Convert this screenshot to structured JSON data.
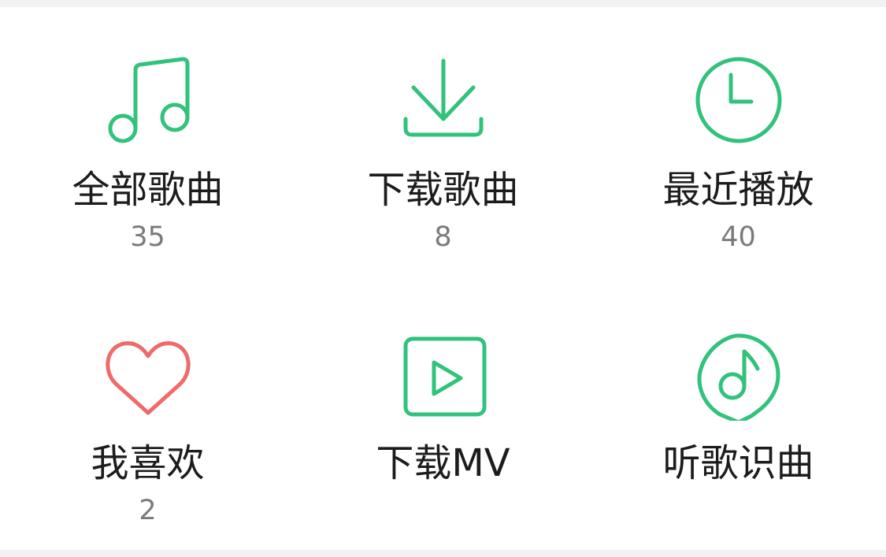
{
  "colors": {
    "accent": "#31c27c",
    "favorite": "#ef6b6b",
    "label": "#1c1c1c",
    "count": "#7a7a7a"
  },
  "tiles": [
    {
      "label": "全部歌曲",
      "count": "35",
      "icon": "music-note-icon"
    },
    {
      "label": "下载歌曲",
      "count": "8",
      "icon": "download-icon"
    },
    {
      "label": "最近播放",
      "count": "40",
      "icon": "clock-icon"
    },
    {
      "label": "我喜欢",
      "count": "2",
      "icon": "heart-icon"
    },
    {
      "label": "下载MV",
      "count": "",
      "icon": "play-video-icon"
    },
    {
      "label": "听歌识曲",
      "count": "",
      "icon": "song-recognition-icon"
    }
  ]
}
